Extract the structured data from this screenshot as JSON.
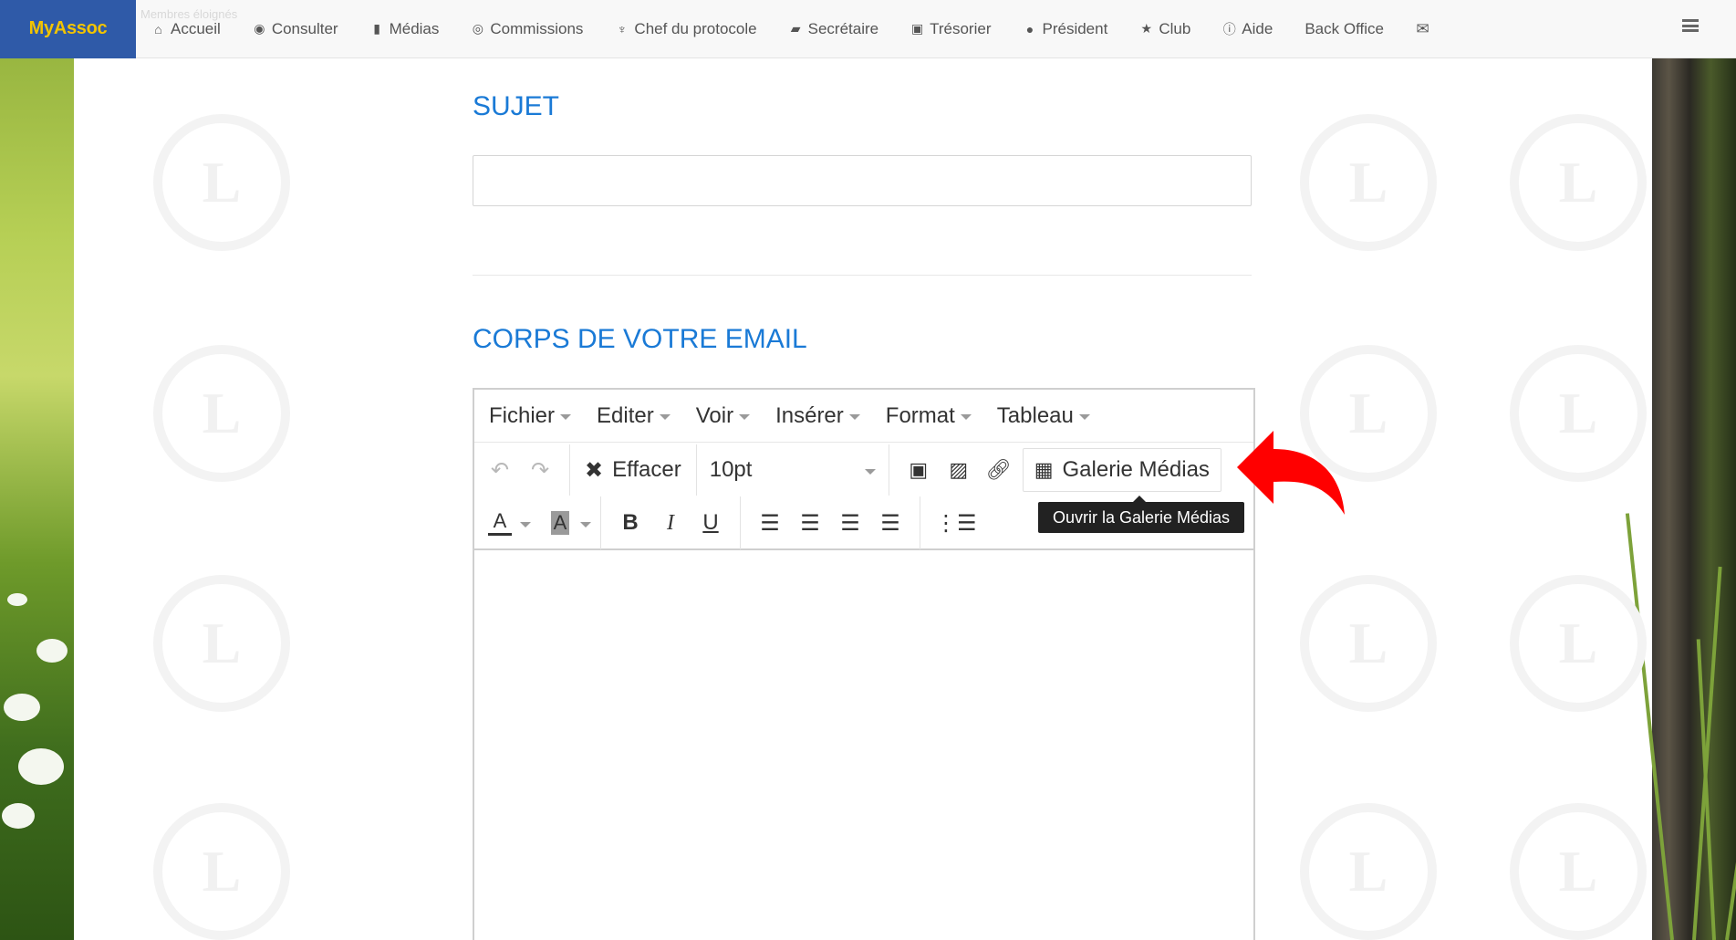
{
  "navbar": {
    "brand": "MyAssoc",
    "ghost_text": "Membres éloignés",
    "items": [
      {
        "label": "Accueil",
        "icon": "home-icon"
      },
      {
        "label": "Consulter",
        "icon": "eye-icon"
      },
      {
        "label": "Médias",
        "icon": "file-icon"
      },
      {
        "label": "Commissions",
        "icon": "user-circle-icon"
      },
      {
        "label": "Chef du protocole",
        "icon": "trophy-icon"
      },
      {
        "label": "Secrétaire",
        "icon": "book-icon"
      },
      {
        "label": "Trésorier",
        "icon": "money-icon"
      },
      {
        "label": "Président",
        "icon": "globe-icon"
      },
      {
        "label": "Club",
        "icon": "star-icon"
      },
      {
        "label": "Aide",
        "icon": "info-icon"
      },
      {
        "label": "Back Office",
        "icon": ""
      }
    ]
  },
  "form": {
    "subject_title": "SUJET",
    "subject_value": "",
    "body_title": "CORPS DE VOTRE EMAIL"
  },
  "editor": {
    "menus": [
      "Fichier",
      "Editer",
      "Voir",
      "Insérer",
      "Format",
      "Tableau"
    ],
    "clear_label": "Effacer",
    "font_size": "10pt",
    "gallery_label": "Galerie Médias",
    "tooltip": "Ouvrir la Galerie Médias"
  },
  "colors": {
    "brand_bg": "#2f5aa8",
    "brand_text": "#f2c400",
    "title_blue": "#1a7ad6",
    "arrow_red": "#ff0000"
  }
}
